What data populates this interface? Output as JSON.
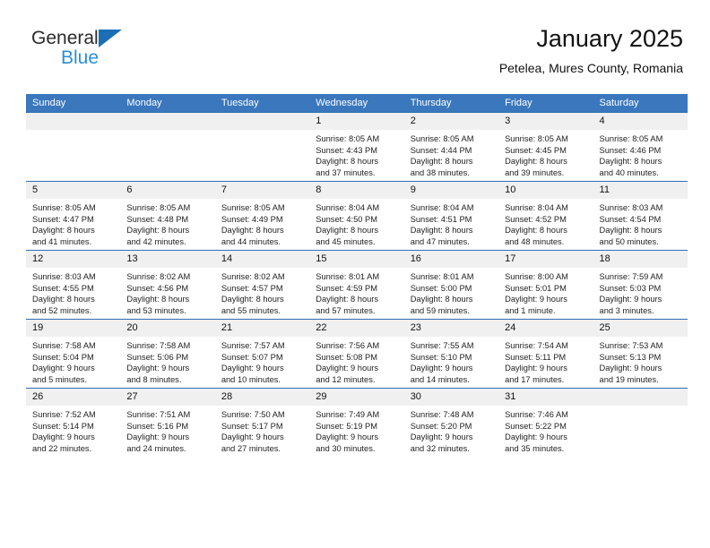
{
  "logo": {
    "line1": "General",
    "line2": "Blue",
    "triangle_color": "#1b6fb5",
    "blue_text_color": "#2b8fd6"
  },
  "header": {
    "title": "January 2025",
    "subtitle": "Petelea, Mures County, Romania"
  },
  "colors": {
    "header_row_bg": "#3a77bd",
    "header_row_text": "#ffffff",
    "date_band_bg": "#f0f0f0",
    "row_separator": "#2f6fb4",
    "page_bg": "#ffffff",
    "body_text": "#222222"
  },
  "weekday_headers": [
    "Sunday",
    "Monday",
    "Tuesday",
    "Wednesday",
    "Thursday",
    "Friday",
    "Saturday"
  ],
  "weeks": [
    [
      {
        "day": "",
        "empty": true,
        "sunrise": "",
        "sunset": "",
        "daylight_line1": "",
        "daylight_line2": ""
      },
      {
        "day": "",
        "empty": true,
        "sunrise": "",
        "sunset": "",
        "daylight_line1": "",
        "daylight_line2": ""
      },
      {
        "day": "",
        "empty": true,
        "sunrise": "",
        "sunset": "",
        "daylight_line1": "",
        "daylight_line2": ""
      },
      {
        "day": "1",
        "empty": false,
        "sunrise": "Sunrise: 8:05 AM",
        "sunset": "Sunset: 4:43 PM",
        "daylight_line1": "Daylight: 8 hours",
        "daylight_line2": "and 37 minutes."
      },
      {
        "day": "2",
        "empty": false,
        "sunrise": "Sunrise: 8:05 AM",
        "sunset": "Sunset: 4:44 PM",
        "daylight_line1": "Daylight: 8 hours",
        "daylight_line2": "and 38 minutes."
      },
      {
        "day": "3",
        "empty": false,
        "sunrise": "Sunrise: 8:05 AM",
        "sunset": "Sunset: 4:45 PM",
        "daylight_line1": "Daylight: 8 hours",
        "daylight_line2": "and 39 minutes."
      },
      {
        "day": "4",
        "empty": false,
        "sunrise": "Sunrise: 8:05 AM",
        "sunset": "Sunset: 4:46 PM",
        "daylight_line1": "Daylight: 8 hours",
        "daylight_line2": "and 40 minutes."
      }
    ],
    [
      {
        "day": "5",
        "empty": false,
        "sunrise": "Sunrise: 8:05 AM",
        "sunset": "Sunset: 4:47 PM",
        "daylight_line1": "Daylight: 8 hours",
        "daylight_line2": "and 41 minutes."
      },
      {
        "day": "6",
        "empty": false,
        "sunrise": "Sunrise: 8:05 AM",
        "sunset": "Sunset: 4:48 PM",
        "daylight_line1": "Daylight: 8 hours",
        "daylight_line2": "and 42 minutes."
      },
      {
        "day": "7",
        "empty": false,
        "sunrise": "Sunrise: 8:05 AM",
        "sunset": "Sunset: 4:49 PM",
        "daylight_line1": "Daylight: 8 hours",
        "daylight_line2": "and 44 minutes."
      },
      {
        "day": "8",
        "empty": false,
        "sunrise": "Sunrise: 8:04 AM",
        "sunset": "Sunset: 4:50 PM",
        "daylight_line1": "Daylight: 8 hours",
        "daylight_line2": "and 45 minutes."
      },
      {
        "day": "9",
        "empty": false,
        "sunrise": "Sunrise: 8:04 AM",
        "sunset": "Sunset: 4:51 PM",
        "daylight_line1": "Daylight: 8 hours",
        "daylight_line2": "and 47 minutes."
      },
      {
        "day": "10",
        "empty": false,
        "sunrise": "Sunrise: 8:04 AM",
        "sunset": "Sunset: 4:52 PM",
        "daylight_line1": "Daylight: 8 hours",
        "daylight_line2": "and 48 minutes."
      },
      {
        "day": "11",
        "empty": false,
        "sunrise": "Sunrise: 8:03 AM",
        "sunset": "Sunset: 4:54 PM",
        "daylight_line1": "Daylight: 8 hours",
        "daylight_line2": "and 50 minutes."
      }
    ],
    [
      {
        "day": "12",
        "empty": false,
        "sunrise": "Sunrise: 8:03 AM",
        "sunset": "Sunset: 4:55 PM",
        "daylight_line1": "Daylight: 8 hours",
        "daylight_line2": "and 52 minutes."
      },
      {
        "day": "13",
        "empty": false,
        "sunrise": "Sunrise: 8:02 AM",
        "sunset": "Sunset: 4:56 PM",
        "daylight_line1": "Daylight: 8 hours",
        "daylight_line2": "and 53 minutes."
      },
      {
        "day": "14",
        "empty": false,
        "sunrise": "Sunrise: 8:02 AM",
        "sunset": "Sunset: 4:57 PM",
        "daylight_line1": "Daylight: 8 hours",
        "daylight_line2": "and 55 minutes."
      },
      {
        "day": "15",
        "empty": false,
        "sunrise": "Sunrise: 8:01 AM",
        "sunset": "Sunset: 4:59 PM",
        "daylight_line1": "Daylight: 8 hours",
        "daylight_line2": "and 57 minutes."
      },
      {
        "day": "16",
        "empty": false,
        "sunrise": "Sunrise: 8:01 AM",
        "sunset": "Sunset: 5:00 PM",
        "daylight_line1": "Daylight: 8 hours",
        "daylight_line2": "and 59 minutes."
      },
      {
        "day": "17",
        "empty": false,
        "sunrise": "Sunrise: 8:00 AM",
        "sunset": "Sunset: 5:01 PM",
        "daylight_line1": "Daylight: 9 hours",
        "daylight_line2": "and 1 minute."
      },
      {
        "day": "18",
        "empty": false,
        "sunrise": "Sunrise: 7:59 AM",
        "sunset": "Sunset: 5:03 PM",
        "daylight_line1": "Daylight: 9 hours",
        "daylight_line2": "and 3 minutes."
      }
    ],
    [
      {
        "day": "19",
        "empty": false,
        "sunrise": "Sunrise: 7:58 AM",
        "sunset": "Sunset: 5:04 PM",
        "daylight_line1": "Daylight: 9 hours",
        "daylight_line2": "and 5 minutes."
      },
      {
        "day": "20",
        "empty": false,
        "sunrise": "Sunrise: 7:58 AM",
        "sunset": "Sunset: 5:06 PM",
        "daylight_line1": "Daylight: 9 hours",
        "daylight_line2": "and 8 minutes."
      },
      {
        "day": "21",
        "empty": false,
        "sunrise": "Sunrise: 7:57 AM",
        "sunset": "Sunset: 5:07 PM",
        "daylight_line1": "Daylight: 9 hours",
        "daylight_line2": "and 10 minutes."
      },
      {
        "day": "22",
        "empty": false,
        "sunrise": "Sunrise: 7:56 AM",
        "sunset": "Sunset: 5:08 PM",
        "daylight_line1": "Daylight: 9 hours",
        "daylight_line2": "and 12 minutes."
      },
      {
        "day": "23",
        "empty": false,
        "sunrise": "Sunrise: 7:55 AM",
        "sunset": "Sunset: 5:10 PM",
        "daylight_line1": "Daylight: 9 hours",
        "daylight_line2": "and 14 minutes."
      },
      {
        "day": "24",
        "empty": false,
        "sunrise": "Sunrise: 7:54 AM",
        "sunset": "Sunset: 5:11 PM",
        "daylight_line1": "Daylight: 9 hours",
        "daylight_line2": "and 17 minutes."
      },
      {
        "day": "25",
        "empty": false,
        "sunrise": "Sunrise: 7:53 AM",
        "sunset": "Sunset: 5:13 PM",
        "daylight_line1": "Daylight: 9 hours",
        "daylight_line2": "and 19 minutes."
      }
    ],
    [
      {
        "day": "26",
        "empty": false,
        "sunrise": "Sunrise: 7:52 AM",
        "sunset": "Sunset: 5:14 PM",
        "daylight_line1": "Daylight: 9 hours",
        "daylight_line2": "and 22 minutes."
      },
      {
        "day": "27",
        "empty": false,
        "sunrise": "Sunrise: 7:51 AM",
        "sunset": "Sunset: 5:16 PM",
        "daylight_line1": "Daylight: 9 hours",
        "daylight_line2": "and 24 minutes."
      },
      {
        "day": "28",
        "empty": false,
        "sunrise": "Sunrise: 7:50 AM",
        "sunset": "Sunset: 5:17 PM",
        "daylight_line1": "Daylight: 9 hours",
        "daylight_line2": "and 27 minutes."
      },
      {
        "day": "29",
        "empty": false,
        "sunrise": "Sunrise: 7:49 AM",
        "sunset": "Sunset: 5:19 PM",
        "daylight_line1": "Daylight: 9 hours",
        "daylight_line2": "and 30 minutes."
      },
      {
        "day": "30",
        "empty": false,
        "sunrise": "Sunrise: 7:48 AM",
        "sunset": "Sunset: 5:20 PM",
        "daylight_line1": "Daylight: 9 hours",
        "daylight_line2": "and 32 minutes."
      },
      {
        "day": "31",
        "empty": false,
        "sunrise": "Sunrise: 7:46 AM",
        "sunset": "Sunset: 5:22 PM",
        "daylight_line1": "Daylight: 9 hours",
        "daylight_line2": "and 35 minutes."
      },
      {
        "day": "",
        "empty": true,
        "sunrise": "",
        "sunset": "",
        "daylight_line1": "",
        "daylight_line2": ""
      }
    ]
  ]
}
